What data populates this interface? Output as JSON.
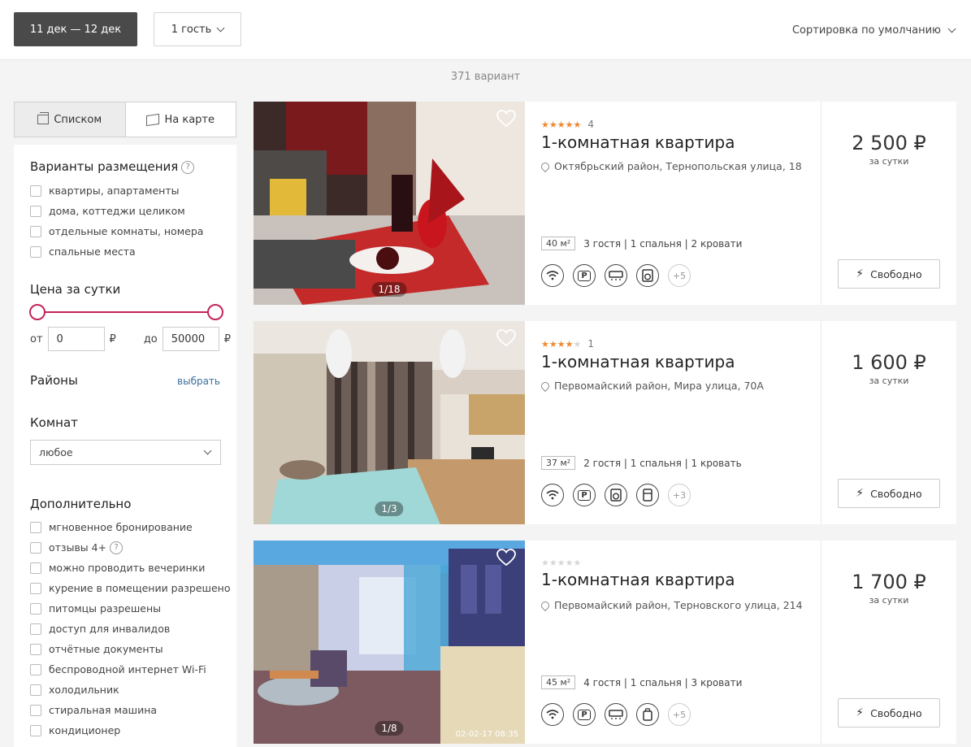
{
  "topbar": {
    "dates": "11 дек — 12 дек",
    "guests": "1 гость",
    "sort": "Сортировка по умолчанию"
  },
  "results_count": "371 вариант",
  "view": {
    "list": "Списком",
    "map": "На карте"
  },
  "filters": {
    "accommodation": {
      "title": "Варианты размещения",
      "help": "?",
      "options": [
        "квартиры, апартаменты",
        "дома, коттеджи целиком",
        "отдельные комнаты, номера",
        "спальные места"
      ]
    },
    "price": {
      "title": "Цена за сутки",
      "from_label": "от",
      "from_value": "0",
      "to_label": "до",
      "to_value": "50000",
      "currency": "₽"
    },
    "districts": {
      "title": "Районы",
      "link": "выбрать"
    },
    "rooms": {
      "title": "Комнат",
      "selected": "любое"
    },
    "extra": {
      "title": "Дополнительно",
      "help": "?",
      "options": [
        "мгновенное бронирование",
        "отзывы 4+",
        "можно проводить вечеринки",
        "курение в помещении разрешено",
        "питомцы разрешены",
        "доступ для инвалидов",
        "отчётные документы",
        "беспроводной интернет Wi-Fi",
        "холодильник",
        "стиральная машина",
        "кондиционер"
      ]
    }
  },
  "listings": [
    {
      "rating_stars": 5,
      "reviews": "4",
      "title": "1-комнатная квартира",
      "address": "Октябрьский район, Тернопольская улица, 18",
      "area": "40 м²",
      "specs": "3 гостя | 1 спальня | 2 кровати",
      "amenities": [
        "wifi-icon",
        "parking-icon",
        "ac-icon",
        "washer-icon"
      ],
      "more": "+5",
      "photo_counter": "1/18",
      "price": "2 500 ₽",
      "per": "за сутки",
      "status": "Свободно"
    },
    {
      "rating_stars": 4,
      "reviews": "1",
      "title": "1-комнатная квартира",
      "address": "Первомайский район, Мира улица, 70А",
      "area": "37 м²",
      "specs": "2 гостя | 1 спальня | 1 кровать",
      "amenities": [
        "wifi-icon",
        "parking-icon",
        "washer-icon",
        "fridge-icon"
      ],
      "more": "+3",
      "photo_counter": "1/3",
      "price": "1 600 ₽",
      "per": "за сутки",
      "status": "Свободно"
    },
    {
      "rating_stars": 0,
      "reviews": "",
      "title": "1-комнатная квартира",
      "address": "Первомайский район, Терновского улица, 214",
      "area": "45 м²",
      "specs": "4 гостя | 1 спальня | 3 кровати",
      "amenities": [
        "wifi-icon",
        "parking-icon",
        "ac-icon",
        "kettle-icon"
      ],
      "more": "+5",
      "photo_counter": "1/8",
      "photo_stamp": "02-02-17 08:35",
      "price": "1 700 ₽",
      "per": "за сутки",
      "status": "Свободно"
    }
  ],
  "colors": {
    "accent": "#c0265a",
    "star": "#f0882e",
    "dark_button": "#4a4a4a"
  }
}
